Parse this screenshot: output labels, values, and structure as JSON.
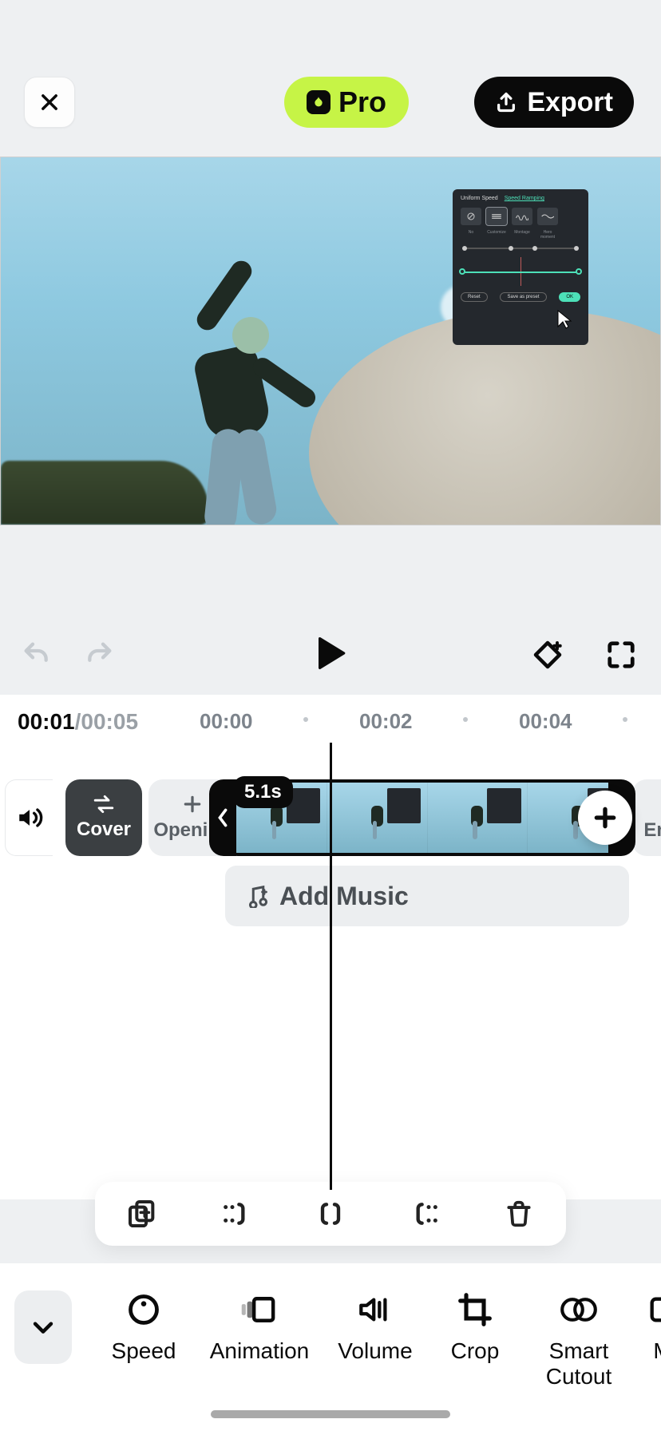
{
  "topbar": {
    "pro_label": "Pro",
    "export_label": "Export"
  },
  "overlay": {
    "tab_uniform": "Uniform Speed",
    "tab_ramping": "Speed Ramping",
    "opt_no": "No",
    "opt_customize": "Customize",
    "opt_montage": "Montage",
    "opt_hero": "Hero moment",
    "btn_reset": "Reset",
    "btn_save": "Save as preset",
    "btn_ok": "OK"
  },
  "playback": {
    "current": "00:01",
    "separator": "/",
    "duration": "00:05"
  },
  "ruler": {
    "t0": "00:00",
    "t2": "00:02",
    "t4": "00:04"
  },
  "strip": {
    "cover_label": "Cover",
    "opening_label": "Opening",
    "ending_label": "Ending",
    "clip_duration_badge": "5.1s",
    "add_music_label": "Add Music"
  },
  "tools": {
    "speed": "Speed",
    "animation": "Animation",
    "volume": "Volume",
    "crop": "Crop",
    "smart_cutout": "Smart\nCutout",
    "more_partial": "M"
  }
}
